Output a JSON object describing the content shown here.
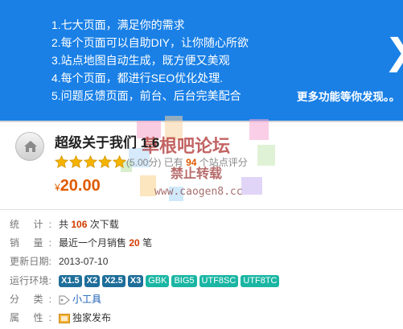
{
  "banner": {
    "lines": [
      "1.七大页面，满足你的需求",
      "2.每个页面可以自助DIY，让你随心所欲",
      "3.站点地图自动生成，既方便又美观",
      "4.每个页面，都进行SEO优化处理.",
      "5.问题反馈页面，前台、后台完美配合"
    ],
    "more_text": "更多功能等你发现。。",
    "arrow_char": "X"
  },
  "product": {
    "title": "超级关于我们 1.6",
    "rating_score": "(5.00分)",
    "rating_prefix": "已有",
    "rating_count": "94",
    "rating_suffix": "个站点评分",
    "stars": 5,
    "currency": "¥",
    "price": "20.00"
  },
  "watermark": {
    "title": "草根吧论坛",
    "subtitle": "禁止转载",
    "url": "www.caogen8.cc"
  },
  "info": {
    "stats_label": "统 计:",
    "stats_prefix": "共",
    "stats_count": "106",
    "stats_suffix": "次下载",
    "sales_label": "销 量:",
    "sales_prefix": "最近一个月销售",
    "sales_count": "20",
    "sales_suffix": "笔",
    "updated_label": "更新日期:",
    "updated_value": "2013-07-10",
    "env_label": "运行环境:",
    "env_tags": [
      "X1.5",
      "X2",
      "X2.5",
      "X3",
      "GBK",
      "BIG5",
      "UTF8SC",
      "UTF8TC"
    ],
    "category_label": "分 类:",
    "category_value": "小工具",
    "attribute_label": "属 性:",
    "attribute_value": "独家发布"
  },
  "colors": {
    "banner_bg": "#1a80e6",
    "price": "#e05a00",
    "highlight": "#d23c00",
    "tag_dark": "#1e6e9a",
    "tag_teal": "#1ab6a3"
  }
}
